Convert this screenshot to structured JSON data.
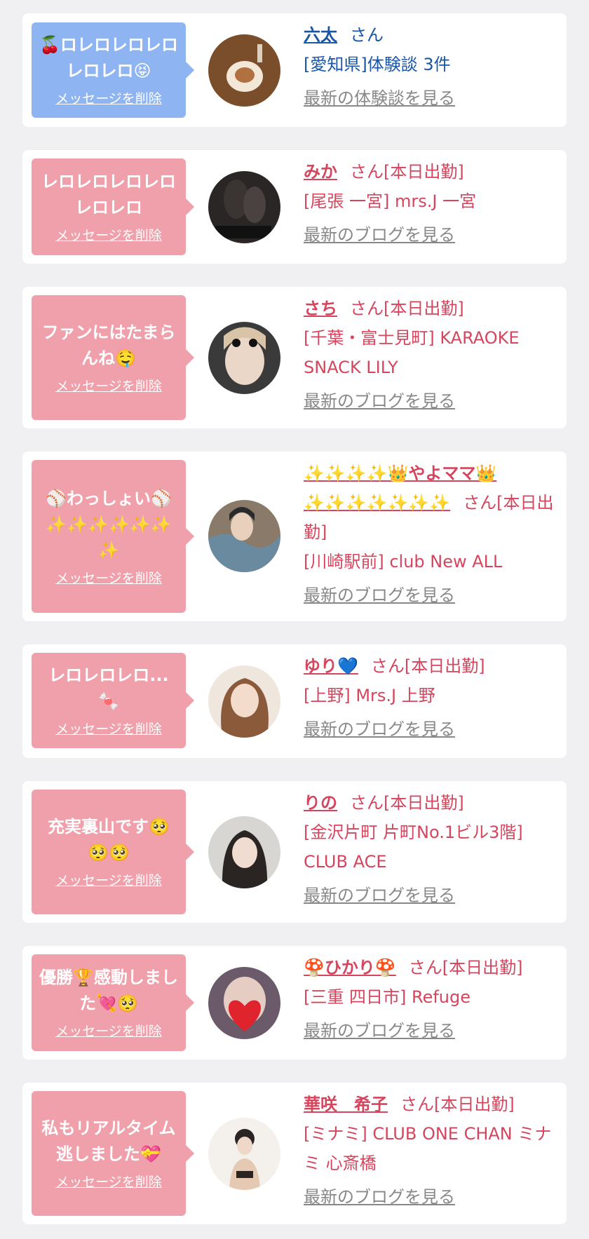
{
  "colors": {
    "page_bg": "#f0f0f2",
    "card_bg": "#ffffff",
    "pink_bubble": "#f0a0ab",
    "blue_bubble": "#8fb4f2",
    "pink_text": "#d6455e",
    "blue_text": "#1a56a6",
    "gray_link": "#888888"
  },
  "entries": [
    {
      "message": "🍒ロレロレロレロレロレロ😝",
      "delete_label": "メッセージを削除",
      "name": "六太",
      "honorific": "さん",
      "store": "[愛知県]体験談 3件",
      "latest_link": "最新の体験談を見る",
      "theme": "blue"
    },
    {
      "message": "レロレロレロレロレロレロ",
      "delete_label": "メッセージを削除",
      "name": "みか",
      "honorific": "さん[本日出勤]",
      "store": "[尾張 一宮] mrs.J 一宮",
      "latest_link": "最新のブログを見る",
      "theme": "pink"
    },
    {
      "message": "ファンにはたまらんね🤤",
      "delete_label": "メッセージを削除",
      "name": "さち",
      "honorific": "さん[本日出勤]",
      "store": "[千葉・富士見町] KARAOKE SNACK LILY",
      "latest_link": "最新のブログを見る",
      "theme": "pink"
    },
    {
      "message": "⚾わっしょい⚾✨✨✨✨✨✨✨",
      "delete_label": "メッセージを削除",
      "name": "✨✨✨✨👑やよママ👑✨✨✨✨✨✨✨",
      "honorific": "さん[本日出勤]",
      "store": "[川崎駅前] club New ALL",
      "latest_link": "最新のブログを見る",
      "theme": "pink"
    },
    {
      "message": "レロレロレロ...🍬",
      "delete_label": "メッセージを削除",
      "name": "ゆり💙",
      "honorific": "さん[本日出勤]",
      "store": "[上野] Mrs.J 上野",
      "latest_link": "最新のブログを見る",
      "theme": "pink"
    },
    {
      "message": "充実裏山です🥺🥺🥺",
      "delete_label": "メッセージを削除",
      "name": "りの",
      "honorific": "さん[本日出勤]",
      "store": "[金沢片町 片町No.1ビル3階] CLUB ACE",
      "latest_link": "最新のブログを見る",
      "theme": "pink"
    },
    {
      "message": "優勝🏆感動しました💘🥺",
      "delete_label": "メッセージを削除",
      "name": "🍄ひかり🍄",
      "honorific": "さん[本日出勤]",
      "store": "[三重 四日市] Refuge",
      "latest_link": "最新のブログを見る",
      "theme": "pink"
    },
    {
      "message": "私もリアルタイム逃しました💝",
      "delete_label": "メッセージを削除",
      "name": "華咲　希子",
      "honorific": "さん[本日出勤]",
      "store": "[ミナミ] CLUB ONE CHAN ミナミ 心斎橋",
      "latest_link": "最新のブログを見る",
      "theme": "pink"
    }
  ]
}
